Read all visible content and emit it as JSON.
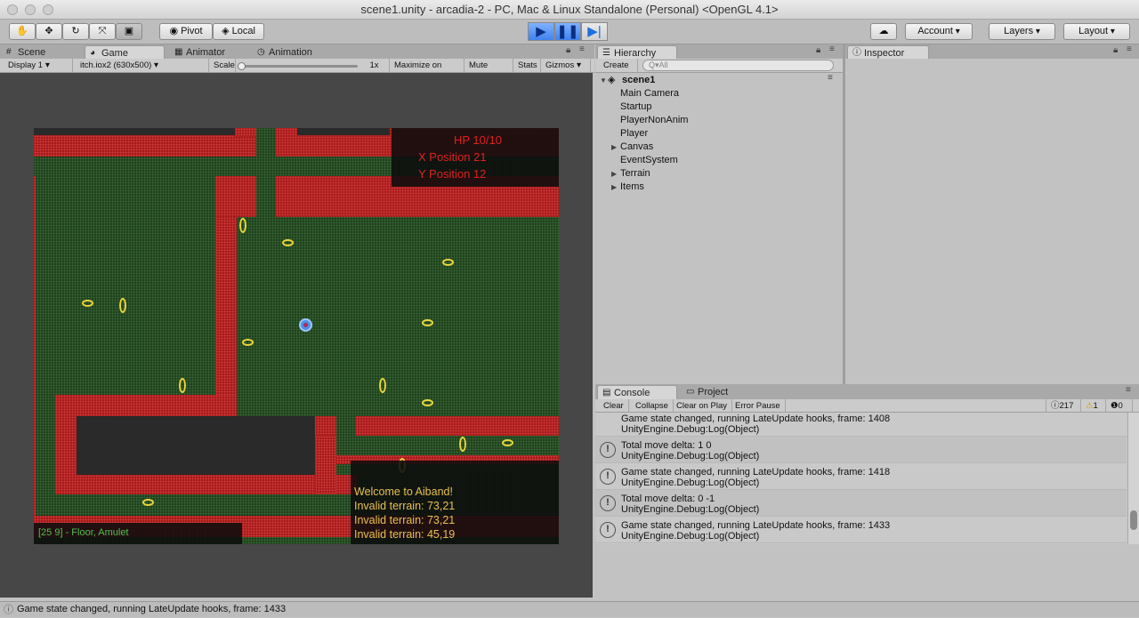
{
  "window": {
    "title": "scene1.unity - arcadia-2 - PC, Mac & Linux Standalone (Personal) <OpenGL 4.1>"
  },
  "toolbar": {
    "tools": [
      "hand-tool",
      "move-tool",
      "rotate-tool",
      "scale-tool",
      "rect-tool"
    ],
    "pivot_label": "Pivot",
    "local_label": "Local",
    "account_label": "Account",
    "layers_label": "Layers",
    "layout_label": "Layout"
  },
  "left_tabs": {
    "scene": "Scene",
    "game": "Game",
    "animator": "Animator",
    "animation": "Animation"
  },
  "game_bar": {
    "display": "Display 1",
    "resolution": "itch.iox2 (630x500)",
    "scale_label": "Scale",
    "scale_value": "1x",
    "maximize": "Maximize on Play",
    "mute": "Mute audio",
    "stats": "Stats",
    "gizmos": "Gizmos"
  },
  "game": {
    "hud": {
      "hp": "HP  10/10",
      "x_position": "X Position  21",
      "y_position": "Y Position  12"
    },
    "messages": [
      "Welcome to Aiband!",
      "Invalid terrain: 73,21",
      "Invalid terrain: 73,21",
      "Invalid terrain: 45,19"
    ],
    "tile_info": "[25 9] - Floor, Amulet",
    "colors": {
      "floor": "#1d3d1d",
      "wall": "#a51616",
      "amulet": "#ead53a",
      "player": "#4f8fe8",
      "hud_text": "#e02020",
      "message_text": "#e8c050",
      "tile_text": "#50c050"
    }
  },
  "hierarchy": {
    "tab": "Hierarchy",
    "create": "Create",
    "search_placeholder": "Q▾All",
    "scene": "scene1",
    "items": [
      "Main Camera",
      "Startup",
      "PlayerNonAnim",
      "Player",
      "Canvas",
      "EventSystem",
      "Terrain",
      "Items"
    ]
  },
  "inspector": {
    "tab": "Inspector"
  },
  "console": {
    "tab": "Console",
    "project_tab": "Project",
    "buttons": [
      "Clear",
      "Collapse",
      "Clear on Play",
      "Error Pause"
    ],
    "counts": {
      "info": "217",
      "warn": "1",
      "error": "0"
    },
    "logs": [
      {
        "line1": "Game state changed, running LateUpdate hooks, frame: 1408",
        "line2": "UnityEngine.Debug:Log(Object)"
      },
      {
        "line1": "Total move delta: 1 0",
        "line2": "UnityEngine.Debug:Log(Object)"
      },
      {
        "line1": "Game state changed, running LateUpdate hooks, frame: 1418",
        "line2": "UnityEngine.Debug:Log(Object)"
      },
      {
        "line1": "Total move delta: 0 -1",
        "line2": "UnityEngine.Debug:Log(Object)"
      },
      {
        "line1": "Game state changed, running LateUpdate hooks, frame: 1433",
        "line2": "UnityEngine.Debug:Log(Object)"
      }
    ]
  },
  "status": {
    "text": "Game state changed, running LateUpdate hooks, frame: 1433"
  }
}
